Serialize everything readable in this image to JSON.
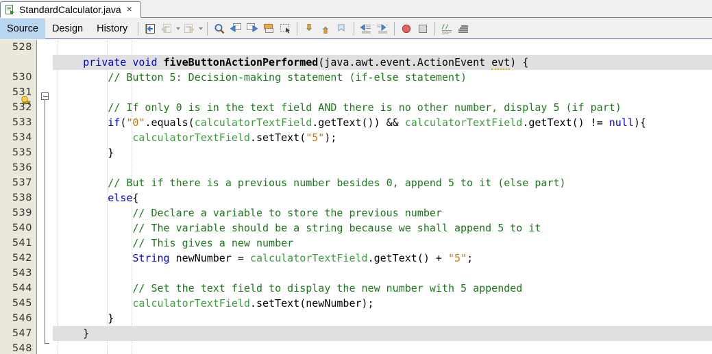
{
  "window": {
    "tab": {
      "title": "StandardCalculator.java",
      "close_label": "×",
      "icon": "java-file-icon"
    }
  },
  "view_tabs": [
    {
      "label": "Source",
      "active": true
    },
    {
      "label": "Design",
      "active": false
    },
    {
      "label": "History",
      "active": false
    }
  ],
  "toolbar": {
    "buttons": [
      {
        "name": "last-edit-position-icon",
        "enabled": true
      },
      {
        "name": "back-icon",
        "enabled": false,
        "has_caret": true
      },
      {
        "name": "forward-icon",
        "enabled": false,
        "has_caret": true
      },
      {
        "name": "find-selection-icon",
        "enabled": true
      },
      {
        "name": "find-previous-icon",
        "enabled": true
      },
      {
        "name": "find-next-icon",
        "enabled": true
      },
      {
        "name": "toggle-highlight-search-icon",
        "enabled": true
      },
      {
        "name": "toggle-rectangular-selection-icon",
        "enabled": true
      },
      {
        "name": "previous-bookmark-icon",
        "enabled": true
      },
      {
        "name": "next-bookmark-icon",
        "enabled": true
      },
      {
        "name": "toggle-bookmark-icon",
        "enabled": true
      },
      {
        "name": "shift-line-left-icon",
        "enabled": true
      },
      {
        "name": "shift-line-right-icon",
        "enabled": true
      },
      {
        "name": "start-macro-recording-icon",
        "enabled": true
      },
      {
        "name": "stop-macro-recording-icon",
        "enabled": true
      },
      {
        "name": "comment-icon",
        "enabled": true
      },
      {
        "name": "uncomment-icon",
        "enabled": true
      }
    ]
  },
  "colors": {
    "accent": "#b8d6f0",
    "gutter_bg": "#e9e8da",
    "highlight_row": "#e0e0e0",
    "keyword": "#0000e6",
    "comment": "#1a7a1a",
    "field": "#3b9e3b",
    "string": "#cc7700",
    "text": "#000000"
  },
  "editor": {
    "first_line": 528,
    "gutter_hint": {
      "line": 529,
      "icon": "warning-bulb-icon"
    },
    "lines": [
      {
        "num": "528",
        "highlight": false,
        "text": ""
      },
      {
        "num": "",
        "highlight": true,
        "text": "    private void fiveButtonActionPerformed(java.awt.event.ActionEvent evt) {"
      },
      {
        "num": "530",
        "highlight": false,
        "text": "        // Button 5: Decision-making statement (if-else statement)"
      },
      {
        "num": "531",
        "highlight": false,
        "text": ""
      },
      {
        "num": "532",
        "highlight": false,
        "text": "        // If only 0 is in the text field AND there is no other number, display 5 (if part)"
      },
      {
        "num": "533",
        "highlight": false,
        "text": "        if(\"0\".equals(calculatorTextField.getText()) && calculatorTextField.getText() != null){"
      },
      {
        "num": "534",
        "highlight": false,
        "text": "            calculatorTextField.setText(\"5\");"
      },
      {
        "num": "535",
        "highlight": false,
        "text": "        }"
      },
      {
        "num": "536",
        "highlight": false,
        "text": ""
      },
      {
        "num": "537",
        "highlight": false,
        "text": "        // But if there is a previous number besides 0, append 5 to it (else part)"
      },
      {
        "num": "538",
        "highlight": false,
        "text": "        else{"
      },
      {
        "num": "539",
        "highlight": false,
        "text": "            // Declare a variable to store the previous number"
      },
      {
        "num": "540",
        "highlight": false,
        "text": "            // The variable should be a string because we shall append 5 to it"
      },
      {
        "num": "541",
        "highlight": false,
        "text": "            // This gives a new number"
      },
      {
        "num": "542",
        "highlight": false,
        "text": "            String newNumber = calculatorTextField.getText() + \"5\";"
      },
      {
        "num": "543",
        "highlight": false,
        "text": ""
      },
      {
        "num": "544",
        "highlight": false,
        "text": "            // Set the text field to display the new number with 5 appended"
      },
      {
        "num": "545",
        "highlight": false,
        "text": "            calculatorTextField.setText(newNumber);"
      },
      {
        "num": "546",
        "highlight": false,
        "text": "        }"
      },
      {
        "num": "547",
        "highlight": true,
        "text": "    }"
      },
      {
        "num": "548",
        "highlight": false,
        "text": ""
      }
    ]
  }
}
